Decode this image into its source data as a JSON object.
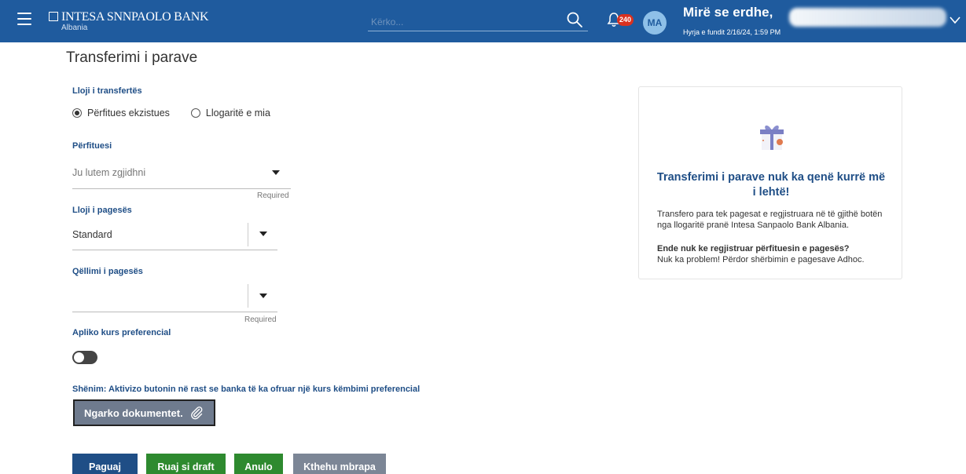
{
  "header": {
    "bank_name": "INTESA SNNPAOLO BANK",
    "bank_sub": "Albania",
    "search_placeholder": "Kërko...",
    "notification_count": "240",
    "avatar_initials": "MA",
    "welcome": "Mirë se erdhe,",
    "last_login": "Hyrja e fundit 2/16/24, 1:59 PM"
  },
  "page": {
    "title": "Transferimi i parave"
  },
  "form": {
    "transfer_type_label": "Lloji i transfertës",
    "radio_existing": "Përfitues ekzistues",
    "radio_own": "Llogaritë e mia",
    "beneficiary_label": "Përfituesi",
    "beneficiary_placeholder": "Ju lutem zgjidhni",
    "required": "Required",
    "payment_type_label": "Lloji i pagesës",
    "payment_type_value": "Standard",
    "purpose_label": "Qëllimi i pagesës",
    "purpose_value": "",
    "preferential_label": "Apliko kurs preferencial",
    "note": "Shënim: Aktivizo butonin në rast se banka të ka ofruar një kurs këmbimi preferencial",
    "upload_label": "Ngarko dokumentet."
  },
  "buttons": {
    "pay": "Paguaj",
    "save_draft": "Ruaj si draft",
    "cancel": "Anulo",
    "back": "Kthehu mbrapa"
  },
  "promo": {
    "title": "Transferimi i parave nuk ka qenë kurrë më i lehtë!",
    "text": "Transfero para tek pagesat e regjistruara në të gjithë botën nga llogaritë pranë Intesa Sanpaolo Bank Albania.",
    "question": "Ende nuk ke regjistruar përfituesin e pagesës?",
    "answer": "Nuk ka problem! Përdor shërbimin e pagesave Adhoc."
  },
  "colors": {
    "header_bg": "#1f5b9e",
    "primary": "#1f4e86",
    "success": "#2e8a2f",
    "muted_button": "#7c8696",
    "badge": "#d9311f"
  }
}
